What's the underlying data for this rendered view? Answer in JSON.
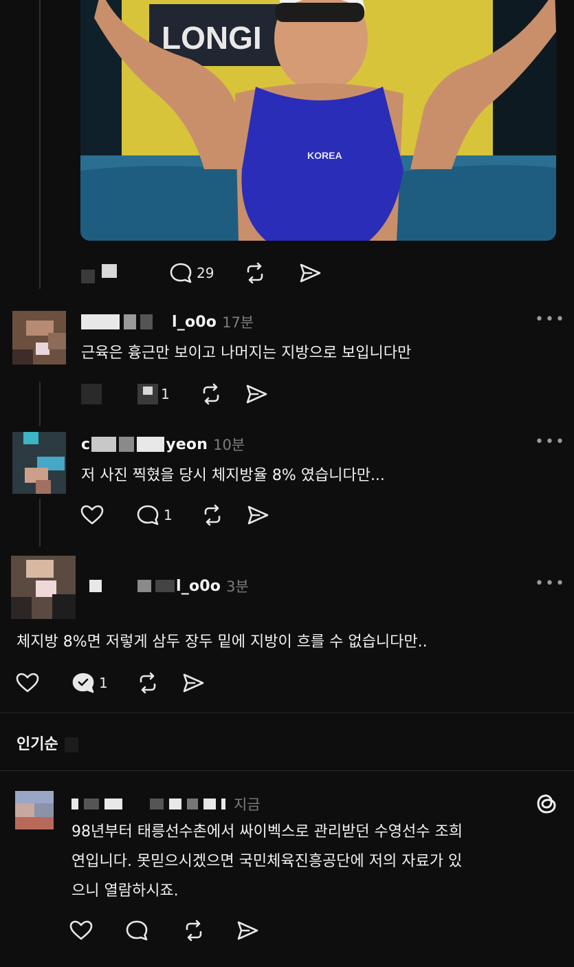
{
  "post": {
    "actions": {
      "comment_count": "29"
    },
    "photo": {
      "banner_text": "LONGI",
      "suit_text": "KOREA"
    }
  },
  "replies": [
    {
      "username": "l_o0o",
      "time": "17분",
      "text": "근육은 흉근만 보이고 나머지는 지방으로 보입니다만",
      "comment_count": "1"
    },
    {
      "username": "c yeon",
      "username_visible_start": "c",
      "username_visible_end": "yeon",
      "time": "10분",
      "text": "저 사진 찍혔을 당시 체지방율 8% 였습니다만...",
      "comment_count": "1"
    },
    {
      "username": "l_o0o",
      "time": "3분",
      "text": "체지방 8%면 저렇게 삼두 장두 밑에 지방이 흐를 수 없습니다만..",
      "comment_count": "1"
    }
  ],
  "sort": {
    "label": "인기순"
  },
  "latest_reply": {
    "time": "지금",
    "text_line1": "98년부터 태릉선수촌에서 싸이벡스로 관리받던 수영선수 조희",
    "text_line2": "연입니다. 못믿으시겠으면 국민체육진흥공단에 저의 자료가 있",
    "text_line3": "으니 열람하시죠."
  },
  "colors": {
    "background": "#0e0e0e",
    "text": "#f2f2f2",
    "muted": "#7d7d7d",
    "divider": "#2a2a2a"
  },
  "icons": [
    "heart-icon",
    "comment-icon",
    "repost-icon",
    "share-icon",
    "more-icon",
    "threads-logo-icon"
  ]
}
